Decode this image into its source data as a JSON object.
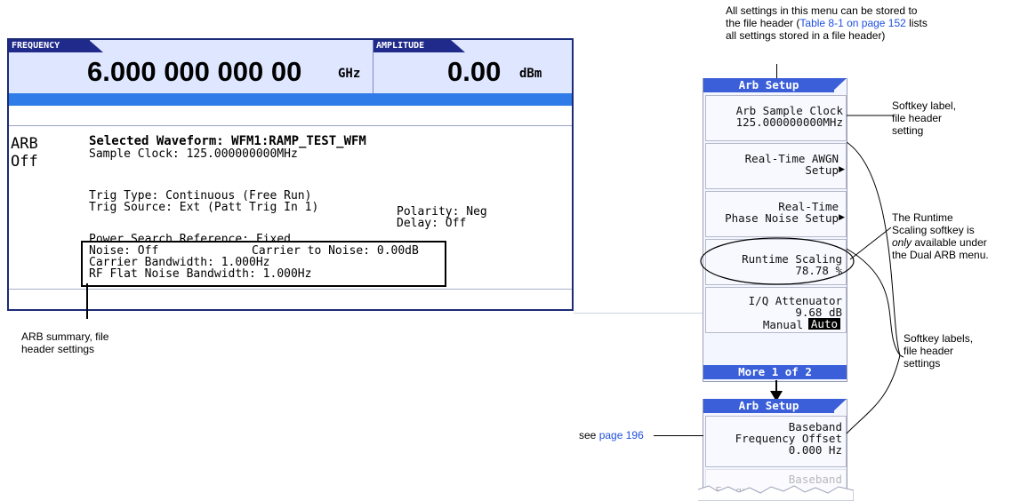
{
  "screen": {
    "frequency_label": "FREQUENCY",
    "frequency_value": "6.000 000 000 00",
    "frequency_unit": "GHz",
    "amplitude_label": "AMPLITUDE",
    "amplitude_value": "0.00",
    "amplitude_unit": "dBm",
    "arb_mode": "ARB",
    "arb_state": "Off",
    "selected_waveform": "Selected Waveform: WFM1:RAMP_TEST_WFM",
    "sample_clock": "Sample Clock: 125.000000000MHz",
    "trig_type": "Trig Type: Continuous (Free Run)",
    "trig_source": "Trig Source: Ext (Patt Trig In 1)",
    "polarity": "Polarity:  Neg",
    "delay": "Delay: Off",
    "power_search": "Power Search Reference: Fixed",
    "noise": "Noise: Off",
    "carrier_to_noise": "Carrier to Noise: 0.00dB",
    "carrier_bandwidth": "Carrier Bandwidth: 1.000Hz",
    "rf_flat_noise": "RF Flat Noise Bandwidth: 1.000Hz"
  },
  "menu1": {
    "title": "Arb Setup",
    "sample_clock_line1": "Arb Sample Clock",
    "sample_clock_line2": "125.000000000MHz",
    "awgn_line1": "Real-Time AWGN",
    "awgn_line2": "Setup",
    "phase_line1": "Real-Time",
    "phase_line2": "Phase Noise Setup",
    "runtime_line1": "Runtime Scaling",
    "runtime_line2": "78.78 %",
    "iq_line1": "I/Q Attenuator",
    "iq_line2": "9.68 dB",
    "iq_manual": "Manual",
    "iq_auto": "Auto",
    "more": "More 1 of 2"
  },
  "menu2": {
    "title": "Arb Setup",
    "bb_line1": "Baseband",
    "bb_line2": "Frequency Offset",
    "bb_line3": "0.000 Hz",
    "bb_faded_line1": "Baseband",
    "bb_faded_line2": "Frequ"
  },
  "annotations": {
    "top_line1": "All settings in this menu can be stored to",
    "top_line2a": "the file header (",
    "top_link": "Table 8-1 on page 152",
    "top_line2b": " lists",
    "top_line3": "all settings stored in a file header)",
    "softkey_label_1": "Softkey label,",
    "softkey_label_2": "file header",
    "softkey_label_3": "setting",
    "runtime_1": "The Runtime",
    "runtime_2": "Scaling softkey is",
    "runtime_3a": "only",
    "runtime_3b": " available under",
    "runtime_4": "the Dual ARB menu.",
    "labels_1": "Softkey labels,",
    "labels_2": "file header",
    "labels_3": "settings",
    "arb_summary_1": "ARB summary, file",
    "arb_summary_2": "header settings",
    "see_page_prefix": "see ",
    "see_page_link": "page 196"
  }
}
